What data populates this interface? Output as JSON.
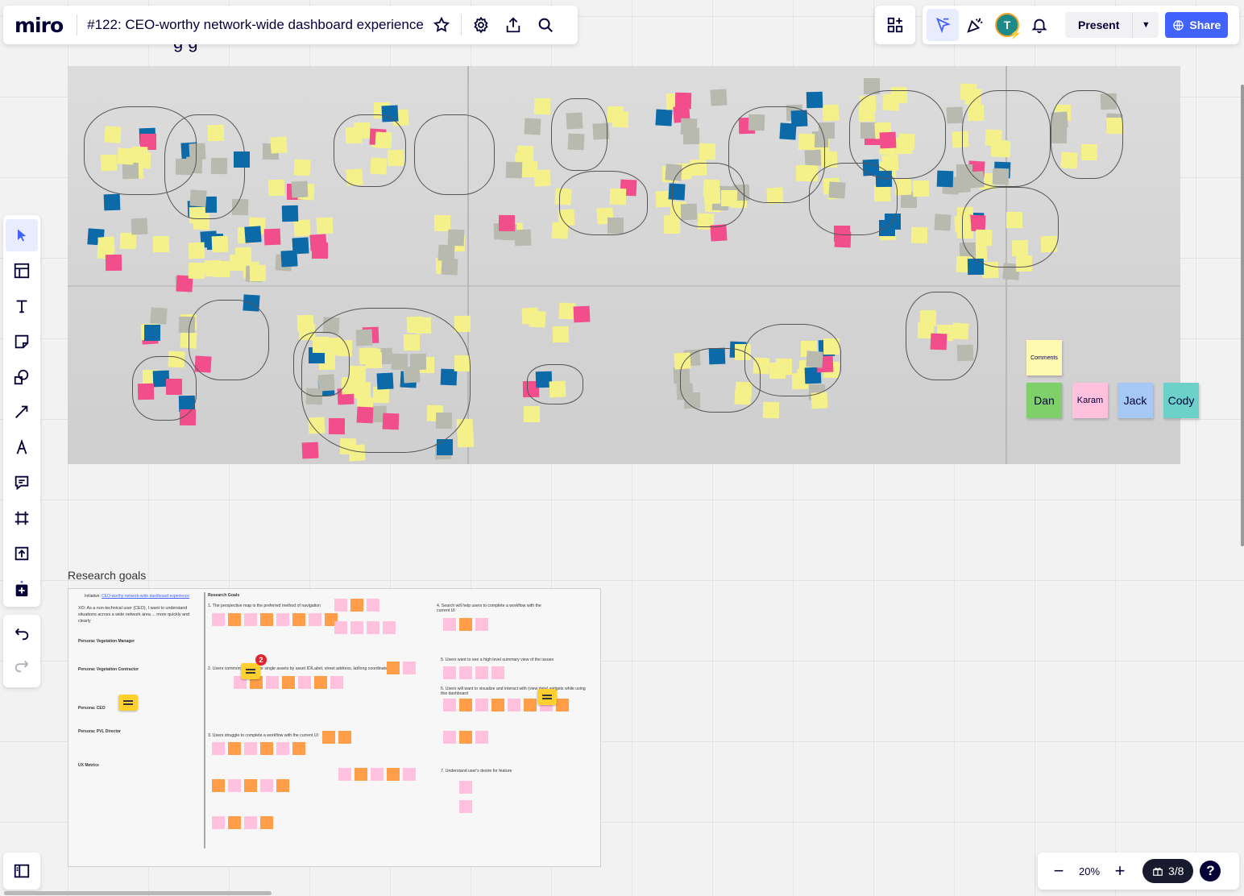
{
  "app": {
    "logo": "miro",
    "board_title": "#122: CEO-worthy network-wide dashboard experience"
  },
  "topbar": {
    "icons": [
      "star-icon",
      "gear-icon",
      "upload-icon",
      "search-icon"
    ]
  },
  "topright": {
    "apps_icon": "apps-icon",
    "avatar_initial": "T",
    "present_label": "Present",
    "share_label": "Share"
  },
  "left_toolbar": {
    "tools": [
      "select",
      "templates",
      "text",
      "sticky-note",
      "shapes",
      "connection-line",
      "pen",
      "comment",
      "frame",
      "upload",
      "more-apps"
    ],
    "history": [
      "undo",
      "redo"
    ]
  },
  "canvas": {
    "partial_heading": "g                       g",
    "legend": {
      "comments_label": "Comments",
      "names": [
        "Dan",
        "Karam",
        "Jack",
        "Cody"
      ]
    },
    "colors": {
      "yellow": "#f5f18a",
      "blue": "#0d6aa8",
      "pink": "#f24e8c",
      "gray": "#b8bab0",
      "green": "#7fd06b",
      "teal": "#6cd1c8",
      "light_pink": "#ffc1de",
      "light_blue": "#a6c8f5",
      "orange": "#ff9d48",
      "legend_yellow": "#fff9b1"
    }
  },
  "research_frame": {
    "title": "Research goals",
    "initiative_label": "Initiative:",
    "initiative_link": "CEO-worthy network-wide dashboard experience",
    "intro": "XO: As a non-technical user (CEO), I want to understand situations across a wide network area ... more quickly and clearly",
    "heading": "Research Goals",
    "goals": [
      "1. The perspective map is the preferred method of navigation",
      "2. Users commonly search for single assets by asset ID/Label, street address, lat/long coordinate",
      "3. Users struggle to complete a workflow with the current UI",
      "4. Search will help users to complete a workflow with the current UI",
      "5. Users want to see a high level summary view of the issues",
      "6. Users will want to visualize and interact with (view data) widgets while using this dashboard",
      "7. Understand user's desire for feature"
    ],
    "personas": [
      "Persona: Vegetation Manager",
      "Persona: Vegetation Contractor",
      "Persona: CEO",
      "Persona: PVL Director"
    ],
    "metrics_heading": "UX Metrics",
    "comment_count": "2"
  },
  "zoom": {
    "value": "20%",
    "pages": "3/8",
    "help": "?"
  }
}
